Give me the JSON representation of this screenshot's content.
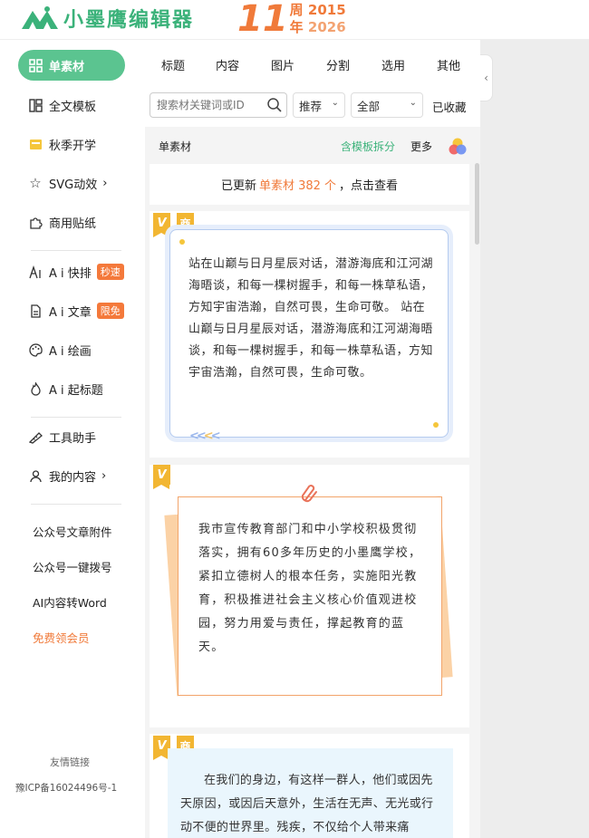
{
  "brand": {
    "logo_text": "小墨鹰编辑器",
    "anniversary_number": "11",
    "anniversary_top": "周",
    "anniversary_bottom": "年",
    "year_start": "2015",
    "year_end": "2026",
    "brand_color": "#3bb27a",
    "accent_color": "#f07a3a"
  },
  "sidebar": {
    "items": [
      {
        "label": "单素材",
        "icon": "grid-icon",
        "active": true
      },
      {
        "label": "全文模板",
        "icon": "layout-icon"
      },
      {
        "label": "秋季开学",
        "icon": "book-icon"
      },
      {
        "label": "SVG动效",
        "icon": "star-icon",
        "chevron": "›"
      },
      {
        "label": "商用贴纸",
        "icon": "puzzle-icon"
      },
      {
        "label": "A i 快排",
        "icon": "ai-icon",
        "tag": "秒速"
      },
      {
        "label": "A i 文章",
        "icon": "document-icon",
        "tag": "限免"
      },
      {
        "label": "A i 绘画",
        "icon": "palette-icon"
      },
      {
        "label": "A i 起标题",
        "icon": "flame-icon"
      },
      {
        "label": "工具助手",
        "icon": "ruler-icon"
      },
      {
        "label": "我的内容",
        "icon": "user-icon",
        "chevron": "›"
      }
    ],
    "links": [
      "公众号文章附件",
      "公众号一键拨号",
      "AI内容转Word",
      "免费领会员"
    ],
    "footer_link": "友情链接",
    "icp": "豫ICP备16024496号-1"
  },
  "tabs": [
    "标题",
    "内容",
    "图片",
    "分割",
    "选用",
    "其他"
  ],
  "search": {
    "placeholder": "搜索材关键词或ID",
    "sort_value": "推荐",
    "scope_value": "全部",
    "favorites": "已收藏"
  },
  "subheader": {
    "title": "单素材",
    "split": "含模板拆分",
    "more": "更多"
  },
  "update_banner": {
    "prefix": "已更新",
    "highlight": "单素材 382 个",
    "suffix": "，点击查看"
  },
  "cards": [
    {
      "badges": [
        "V",
        "商"
      ],
      "text": "站在山巅与日月星辰对话，潜游海底和江河湖海晤谈，和每一棵树握手，和每一株草私语，方知宇宙浩瀚，自然可畏，生命可敬。 站在山巅与日月星辰对话，潜游海底和江河湖海晤谈，和每一棵树握手，和每一株草私语，方知宇宙浩瀚，自然可畏，生命可敬。",
      "decor": "<<<<"
    },
    {
      "badges": [
        "V"
      ],
      "text": "我市宣传教育部门和中小学校积极贯彻落实，拥有60多年历史的小墨鹰学校，紧扣立德树人的根本任务，实施阳光教育，积极推进社会主义核心价值观进校园，努力用爱与责任，撑起教育的蓝天。"
    },
    {
      "badges": [
        "V",
        "商"
      ],
      "text": "在我们的身边，有这样一群人，他们或因先天原因，或因后天意外，生活在无声、无光或行动不便的世界里。残疾，不仅给个人带来痛"
    }
  ],
  "collapse_arrow": "‹"
}
